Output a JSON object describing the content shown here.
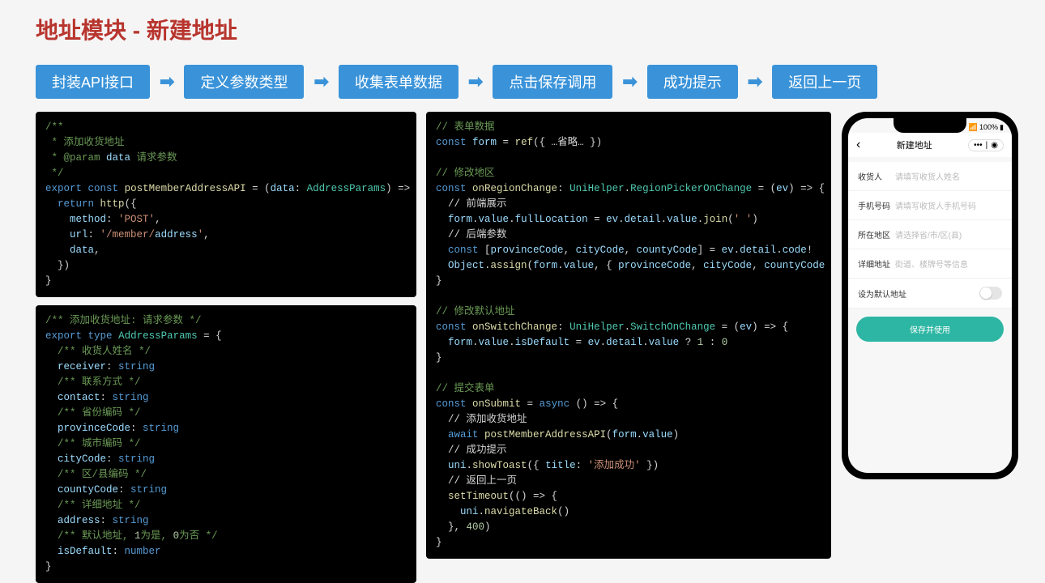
{
  "title": "地址模块 - 新建地址",
  "steps": [
    "封装API接口",
    "定义参数类型",
    "收集表单数据",
    "点击保存调用",
    "成功提示",
    "返回上一页"
  ],
  "code": {
    "api": "/**\n * 添加收货地址\n * @param data 请求参数\n */\nexport const postMemberAddressAPI = (data: AddressParams) => {\n  return http({\n    method: 'POST',\n    url: '/member/address',\n    data,\n  })\n}",
    "types": "/** 添加收货地址: 请求参数 */\nexport type AddressParams = {\n  /** 收货人姓名 */\n  receiver: string\n  /** 联系方式 */\n  contact: string\n  /** 省份编码 */\n  provinceCode: string\n  /** 城市编码 */\n  cityCode: string\n  /** 区/县编码 */\n  countyCode: string\n  /** 详细地址 */\n  address: string\n  /** 默认地址, 1为是, 0为否 */\n  isDefault: number\n}",
    "logic": "// 表单数据\nconst form = ref({ …省略… })\n\n// 修改地区\nconst onRegionChange: UniHelper.RegionPickerOnChange = (ev) => {\n  // 前端展示\n  form.value.fullLocation = ev.detail.value.join(' ')\n  // 后端参数\n  const [provinceCode, cityCode, countyCode] = ev.detail.code!\n  Object.assign(form.value, { provinceCode, cityCode, countyCode })\n}\n\n// 修改默认地址\nconst onSwitchChange: UniHelper.SwitchOnChange = (ev) => {\n  form.value.isDefault = ev.detail.value ? 1 : 0\n}\n\n// 提交表单\nconst onSubmit = async () => {\n  // 添加收货地址\n  await postMemberAddressAPI(form.value)\n  // 成功提示\n  uni.showToast({ title: '添加成功' })\n  // 返回上一页\n  setTimeout(() => {\n    uni.navigateBack()\n  }, 400)\n}"
  },
  "phone": {
    "statusBattery": "100%",
    "title": "新建地址",
    "rows": [
      {
        "label": "收货人",
        "placeholder": "请填写收货人姓名"
      },
      {
        "label": "手机号码",
        "placeholder": "请填写收货人手机号码"
      },
      {
        "label": "所在地区",
        "placeholder": "请选择省/市/区(县)"
      },
      {
        "label": "详细地址",
        "placeholder": "街道、楼牌号等信息"
      }
    ],
    "defaultLabel": "设为默认地址",
    "saveBtn": "保存并使用"
  }
}
